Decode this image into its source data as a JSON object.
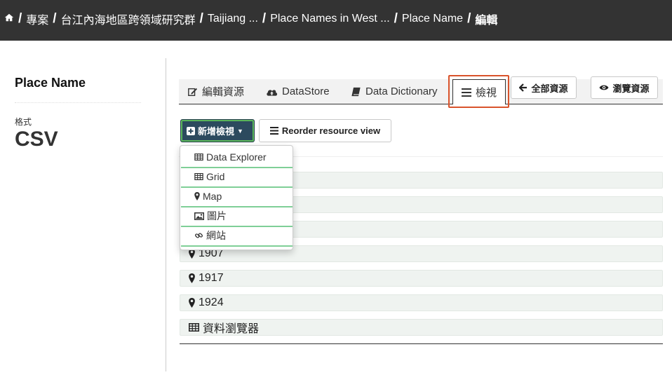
{
  "breadcrumb": {
    "home_icon": "home-icon",
    "items": [
      "專案",
      "台江內海地區跨領域研究群",
      "Taijiang ...",
      "Place Names in West ...",
      "Place Name",
      "編輯"
    ]
  },
  "sidebar": {
    "title": "Place Name",
    "format_label": "格式",
    "format_value": "CSV"
  },
  "tabs": {
    "edit_resource": "編輯資源",
    "datastore": "DataStore",
    "data_dictionary": "Data Dictionary",
    "views": "檢視"
  },
  "actions": {
    "all_resources": "全部資源",
    "view_resource": "瀏覽資源"
  },
  "toolbar": {
    "new_view": "新增檢視",
    "reorder": "Reorder resource view"
  },
  "dropdown": {
    "items": [
      {
        "label": "Data Explorer",
        "icon": "table-icon"
      },
      {
        "label": "Grid",
        "icon": "grid-icon"
      },
      {
        "label": "Map",
        "icon": "map-marker-icon"
      },
      {
        "label": "圖片",
        "icon": "image-icon"
      },
      {
        "label": "網站",
        "icon": "link-icon"
      }
    ]
  },
  "views": [
    {
      "label": "",
      "icon": ""
    },
    {
      "label": "",
      "icon": ""
    },
    {
      "label": "",
      "icon": ""
    },
    {
      "label": "1907",
      "icon": "map-marker-icon"
    },
    {
      "label": "1917",
      "icon": "map-marker-icon"
    },
    {
      "label": "1924",
      "icon": "map-marker-icon"
    },
    {
      "label": "資料瀏覽器",
      "icon": "table-icon"
    }
  ],
  "colors": {
    "topbar": "#333333",
    "primary_button": "#2c4a5e",
    "highlight": "#d9532b",
    "dropdown_separator": "#7fcf97",
    "view_row_bg": "#eff3f0"
  }
}
